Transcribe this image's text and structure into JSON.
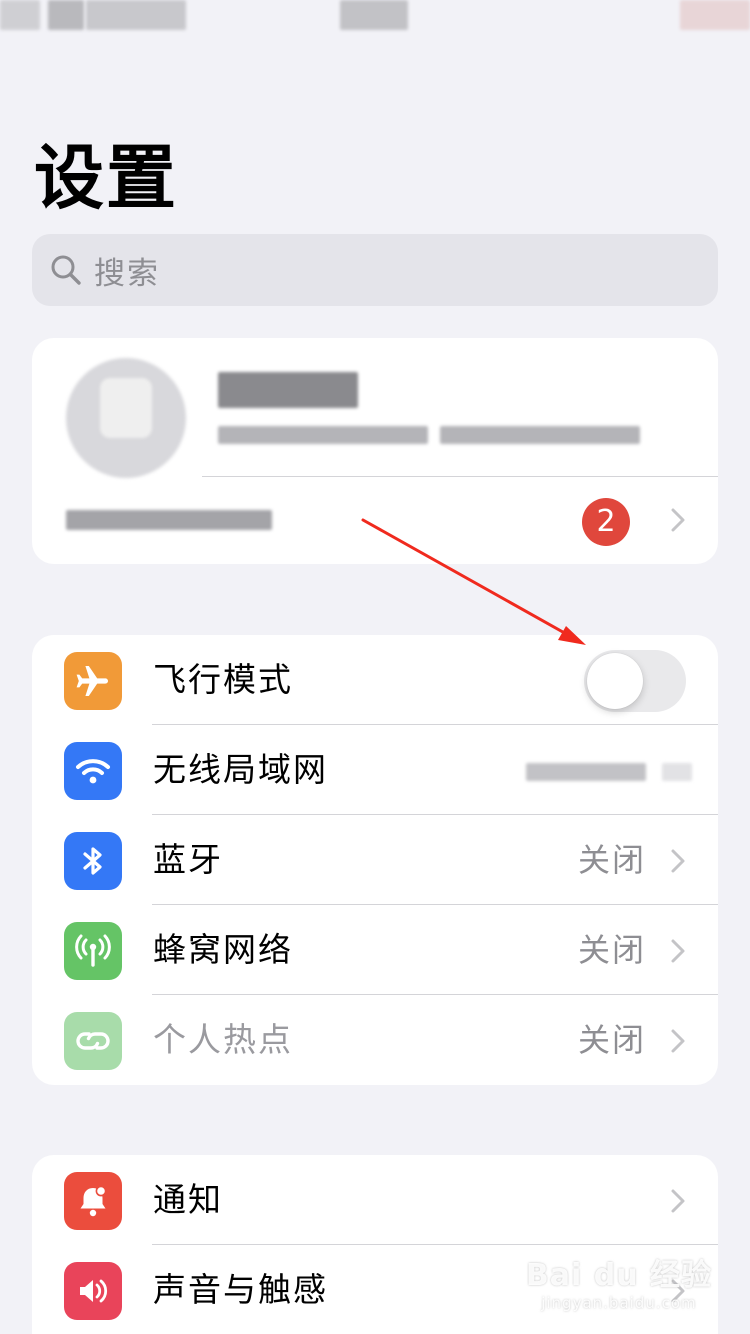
{
  "page": {
    "title": "设置"
  },
  "search": {
    "placeholder": "搜索"
  },
  "profile": {
    "badge_count": "2"
  },
  "group1": {
    "items": [
      {
        "label": "飞行模式",
        "value": "",
        "icon": "airplane-icon",
        "color": "#f19a38",
        "toggle_on": false
      },
      {
        "label": "无线局域网",
        "value": "",
        "icon": "wifi-icon",
        "color": "#3478f6"
      },
      {
        "label": "蓝牙",
        "value": "关闭",
        "icon": "bluetooth-icon",
        "color": "#3478f6"
      },
      {
        "label": "蜂窝网络",
        "value": "关闭",
        "icon": "antenna-icon",
        "color": "#65c466"
      },
      {
        "label": "个人热点",
        "value": "关闭",
        "icon": "hotspot-icon",
        "color": "#a8dcaa",
        "disabled": true
      }
    ]
  },
  "group2": {
    "items": [
      {
        "label": "通知",
        "icon": "notification-icon",
        "color": "#eb4d3d"
      },
      {
        "label": "声音与触感",
        "icon": "speaker-icon",
        "color": "#e9445a"
      }
    ]
  },
  "watermark": {
    "main": "Bai du 经验",
    "sub": "jingyan.baidu.com"
  },
  "colors": {
    "badge": "#e0473c",
    "annotation_arrow": "#f02a1e",
    "background": "#f2f2f7"
  }
}
